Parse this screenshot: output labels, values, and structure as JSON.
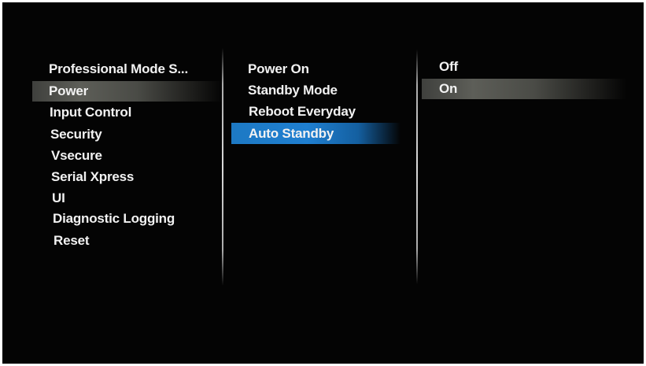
{
  "menu": {
    "items": [
      {
        "label": "Professional Mode S..."
      },
      {
        "label": "Power"
      },
      {
        "label": "Input Control"
      },
      {
        "label": "Security"
      },
      {
        "label": "Vsecure"
      },
      {
        "label": "Serial Xpress"
      },
      {
        "label": "UI"
      },
      {
        "label": "Diagnostic Logging"
      },
      {
        "label": "Reset"
      }
    ],
    "selected": "Power"
  },
  "submenu": {
    "items": [
      {
        "label": "Power On"
      },
      {
        "label": "Standby Mode"
      },
      {
        "label": "Reboot Everyday"
      },
      {
        "label": "Auto Standby"
      }
    ],
    "selected": "Auto Standby"
  },
  "options": {
    "items": [
      {
        "label": "Off"
      },
      {
        "label": "On"
      }
    ],
    "selected": "On"
  },
  "colors": {
    "background": "#040404",
    "text": "#f2f2f2",
    "highlight_grey": "#5d5e58",
    "highlight_blue": "#1f7fd0"
  }
}
